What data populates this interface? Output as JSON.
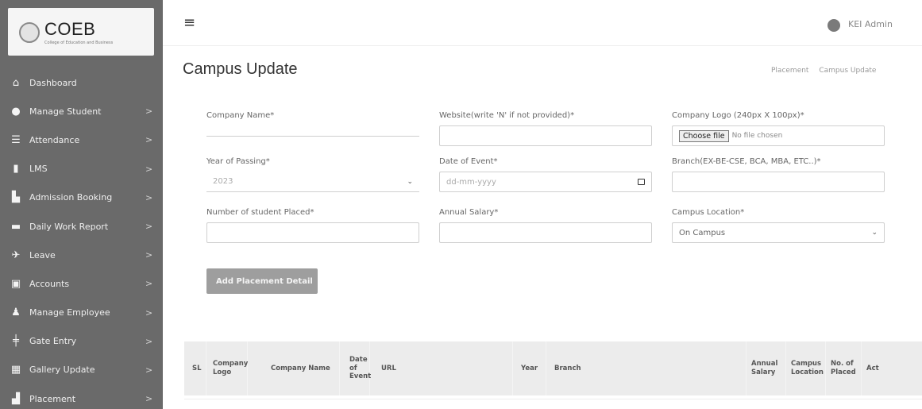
{
  "brand": {
    "name": "COEB",
    "subtitle": "College of Education and Business"
  },
  "sidebar": {
    "items": [
      {
        "label": "Dashboard",
        "icon": "home-icon",
        "has_arrow": false
      },
      {
        "label": "Manage Student",
        "icon": "user-icon",
        "has_arrow": true
      },
      {
        "label": "Attendance",
        "icon": "list-icon",
        "has_arrow": true
      },
      {
        "label": "LMS",
        "icon": "book-icon",
        "has_arrow": true
      },
      {
        "label": "Admission Booking",
        "icon": "building-icon",
        "has_arrow": true
      },
      {
        "label": "Daily Work Report",
        "icon": "briefcase-icon",
        "has_arrow": true
      },
      {
        "label": "Leave",
        "icon": "plane-icon",
        "has_arrow": true
      },
      {
        "label": "Accounts",
        "icon": "money-icon",
        "has_arrow": true
      },
      {
        "label": "Manage Employee",
        "icon": "users-icon",
        "has_arrow": true
      },
      {
        "label": "Gate Entry",
        "icon": "gate-icon",
        "has_arrow": true
      },
      {
        "label": "Gallery Update",
        "icon": "image-icon",
        "has_arrow": true
      },
      {
        "label": "Placement",
        "icon": "placement-icon",
        "has_arrow": true
      }
    ],
    "arrow_glyph": ">"
  },
  "topbar": {
    "menu_glyph": "≡",
    "user_name": "KEI Admin"
  },
  "page": {
    "title": "Campus Update",
    "breadcrumb": [
      "Placement",
      "Campus Update"
    ]
  },
  "form": {
    "company_name": {
      "label": "Company Name*",
      "value": ""
    },
    "website": {
      "label": "Website(write 'N' if not provided)*",
      "value": ""
    },
    "company_logo": {
      "label": "Company Logo (240px X 100px)*",
      "button": "Choose file",
      "status": "No file chosen"
    },
    "year_of_passing": {
      "label": "Year of Passing*",
      "value": "2023"
    },
    "date_of_event": {
      "label": "Date of Event*",
      "value": "dd-mm-yyyy"
    },
    "branch": {
      "label": "Branch(EX-BE-CSE, BCA, MBA, ETC..)*",
      "value": ""
    },
    "students_placed": {
      "label": "Number of student Placed*",
      "value": ""
    },
    "annual_salary": {
      "label": "Annual Salary*",
      "value": ""
    },
    "campus_location": {
      "label": "Campus Location*",
      "value": "On Campus"
    },
    "submit_label": "Add Placement Detail"
  },
  "table": {
    "headers": [
      "SL",
      "Company Logo",
      "Company Name",
      "Date of Event",
      "URL",
      "Year",
      "Branch",
      "Annual Salary",
      "Campus Location",
      "No. of Placed",
      "Act"
    ]
  },
  "colors": {
    "sidebar_bg": "#6a6a6a",
    "button_bg": "#9e9e9e",
    "table_header_bg": "#ececec"
  }
}
